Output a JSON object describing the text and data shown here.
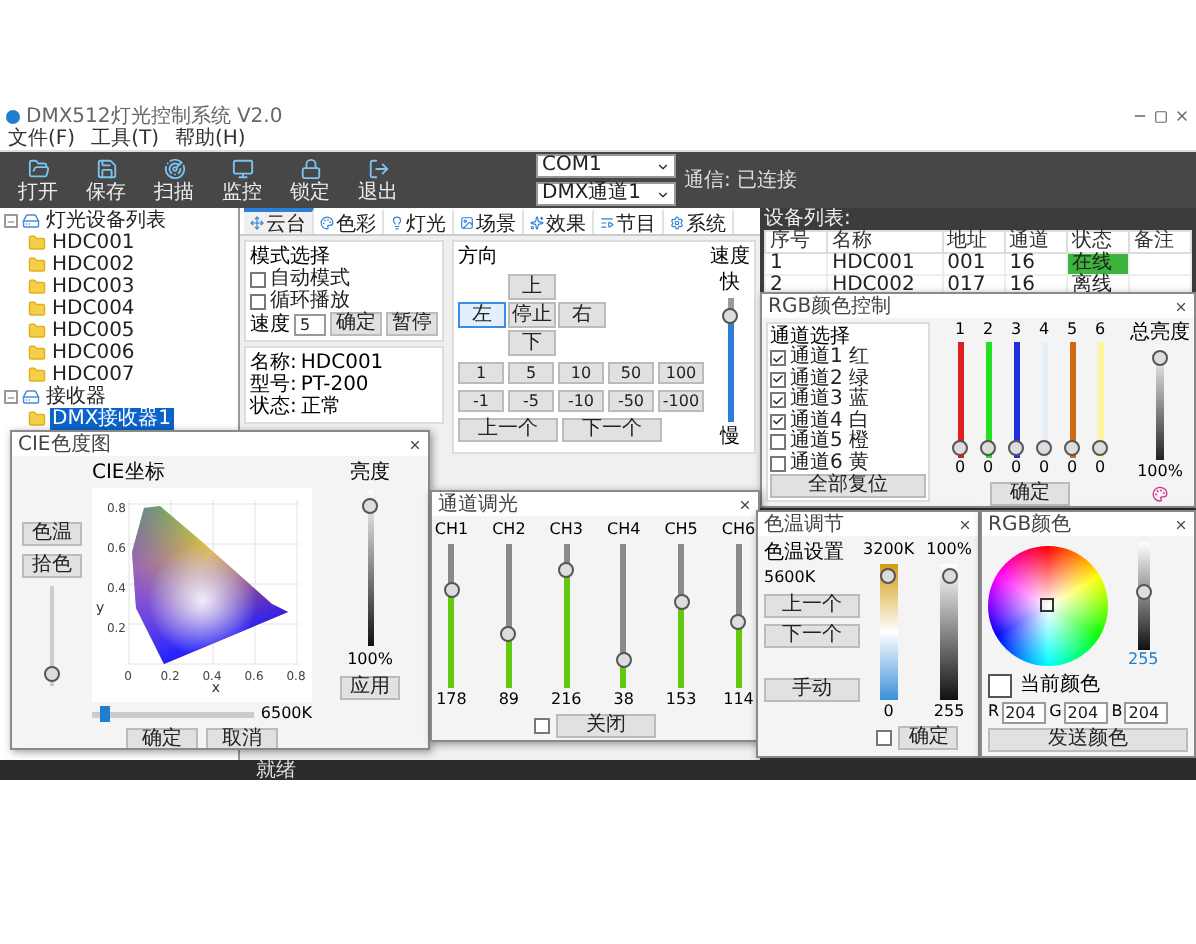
{
  "window": {
    "title": "DMX512灯光控制系统 V2.0"
  },
  "menu": [
    "文件(F)",
    "工具(T)",
    "帮助(H)"
  ],
  "toolbar": {
    "buttons": [
      {
        "label": "打开",
        "kind": "open"
      },
      {
        "label": "保存",
        "kind": "save"
      },
      {
        "label": "扫描",
        "kind": "scan"
      },
      {
        "label": "监控",
        "kind": "monitor"
      },
      {
        "label": "锁定",
        "kind": "lock"
      },
      {
        "label": "退出",
        "kind": "exit"
      }
    ],
    "port": "COM1",
    "universe": "DMX通道1",
    "status": "通信: 已连接"
  },
  "tree": [
    {
      "label": "灯光设备列表",
      "expanded": true,
      "selected": false,
      "children": [
        {
          "label": "HDC001",
          "selected": false
        },
        {
          "label": "HDC002",
          "selected": false
        },
        {
          "label": "HDC003",
          "selected": false
        },
        {
          "label": "HDC004",
          "selected": false
        },
        {
          "label": "HDC005",
          "selected": false
        },
        {
          "label": "HDC006",
          "selected": false
        },
        {
          "label": "HDC007",
          "selected": false
        }
      ]
    },
    {
      "label": "接收器",
      "expanded": true,
      "selected": false,
      "children": [
        {
          "label": "DMX接收器1",
          "selected": true
        }
      ]
    }
  ],
  "tabs": [
    {
      "label": "云台",
      "selected": true
    },
    {
      "label": "色彩",
      "selected": false
    },
    {
      "label": "灯光",
      "selected": false
    },
    {
      "label": "场景",
      "selected": false
    },
    {
      "label": "效果",
      "selected": false
    },
    {
      "label": "节目",
      "selected": false
    },
    {
      "label": "系统",
      "selected": false
    }
  ],
  "mode_group": {
    "title": "模式选择",
    "options": [
      {
        "label": "自动模式",
        "checked": false
      },
      {
        "label": "循环播放",
        "checked": false
      }
    ],
    "speed_label": "速度",
    "speed_value": "5",
    "buttons": [
      "确定",
      "暂停"
    ]
  },
  "info": [
    {
      "label": "名称:",
      "value": "HDC001"
    },
    {
      "label": "型号:",
      "value": "PT-200"
    },
    {
      "label": "状态:",
      "value": "正常"
    }
  ],
  "direction": {
    "title": "方向",
    "pad": [
      {
        "label": "上",
        "selected": false
      },
      {
        "label": "左",
        "selected": true
      },
      {
        "label": "停止",
        "selected": false
      },
      {
        "label": "右",
        "selected": false
      },
      {
        "label": "下",
        "selected": false
      }
    ],
    "steps": [
      "1",
      "5",
      "10",
      "50",
      "100"
    ],
    "steps_back": [
      "-1",
      "-5",
      "-10",
      "-50",
      "-100"
    ],
    "actions": [
      "上一个",
      "下一个"
    ],
    "speed": {
      "label": "速度",
      "level": 0.9,
      "high": "快",
      "low": "慢"
    }
  },
  "table": {
    "title": "设备列表:",
    "columns": [
      "序号",
      "名称",
      "地址",
      "通道",
      "状态",
      "备注"
    ],
    "rows": [
      {
        "cells": [
          "1",
          "HDC001",
          "001",
          "16",
          "在线"
        ],
        "online": true
      },
      {
        "cells": [
          "2",
          "HDC002",
          "017",
          "16",
          "离线"
        ],
        "online": false
      }
    ]
  },
  "rgb": {
    "title": "RGB颜色控制",
    "group": "通道选择",
    "options": [
      {
        "label": "通道1 红",
        "checked": true
      },
      {
        "label": "通道2 绿",
        "checked": true
      },
      {
        "label": "通道3 蓝",
        "checked": true
      },
      {
        "label": "通道4 白",
        "checked": true
      },
      {
        "label": "通道5 橙",
        "checked": false
      },
      {
        "label": "通道6 黄",
        "checked": false
      }
    ],
    "button": "全部复位",
    "channels": [
      {
        "label": "1",
        "color": "#e02020",
        "level": 0.02,
        "value": "0"
      },
      {
        "label": "2",
        "color": "#20e020",
        "level": 0.02,
        "value": "0"
      },
      {
        "label": "3",
        "color": "#2030e0",
        "level": 0.02,
        "value": "0"
      },
      {
        "label": "4",
        "color": "#e6eef8",
        "level": 0.02,
        "value": "0"
      },
      {
        "label": "5",
        "color": "#d06a10",
        "level": 0.02,
        "value": "0"
      },
      {
        "label": "6",
        "color": "#fff59a",
        "level": 0.02,
        "value": "0"
      }
    ],
    "master": {
      "label": "总亮度",
      "level": 0.97,
      "value": "100%"
    },
    "ok": "确定"
  },
  "cie": {
    "title": "CIE色度图",
    "coord_label": "CIE坐标",
    "brightness_label": "亮度",
    "buttons_left": [
      "色温",
      "拾色"
    ],
    "left_slider": {
      "level": 0.05
    },
    "xticks": [
      "0",
      "0.2",
      "0.4",
      "0.6",
      "0.8"
    ],
    "yticks": [
      "0.8",
      "0.6",
      "0.4",
      "0.2"
    ],
    "axis_x": "x",
    "axis_y": "y",
    "right_slider": {
      "level": 0.95
    },
    "right_value": "100%",
    "apply": "应用",
    "h_slider": {
      "level": 0.05
    },
    "h_value": "6500K",
    "buttons": [
      "确定",
      "取消"
    ]
  },
  "dimmer": {
    "title": "通道调光",
    "channels": [
      {
        "label": "CH1",
        "level": 0.7,
        "value": "178"
      },
      {
        "label": "CH2",
        "level": 0.35,
        "value": "89"
      },
      {
        "label": "CH3",
        "level": 0.85,
        "value": "216"
      },
      {
        "label": "CH4",
        "level": 0.15,
        "value": "38"
      },
      {
        "label": "CH5",
        "level": 0.6,
        "value": "153"
      },
      {
        "label": "CH6",
        "level": 0.45,
        "value": "114"
      }
    ],
    "sync": {
      "checked": false
    },
    "button": "关闭"
  },
  "ctemp": {
    "title": "色温调节",
    "label": "色温设置",
    "current": "5600K",
    "buttons": [
      "上一个",
      "下一个"
    ],
    "mode": "手动",
    "warm": {
      "label": "3200K",
      "level": 0.97,
      "value": "0"
    },
    "bright": {
      "label": "100%",
      "level": 0.97,
      "value": "255"
    },
    "sync": {
      "checked": false
    },
    "ok": "确定"
  },
  "wheel": {
    "title": "RGB颜色",
    "current": "当前颜色",
    "gray": {
      "level": 0.55,
      "value": "255"
    },
    "fields": [
      {
        "label": "R",
        "value": "204"
      },
      {
        "label": "G",
        "value": "204"
      },
      {
        "label": "B",
        "value": "204"
      }
    ],
    "button": "发送颜色"
  },
  "status_bar": "就绪"
}
